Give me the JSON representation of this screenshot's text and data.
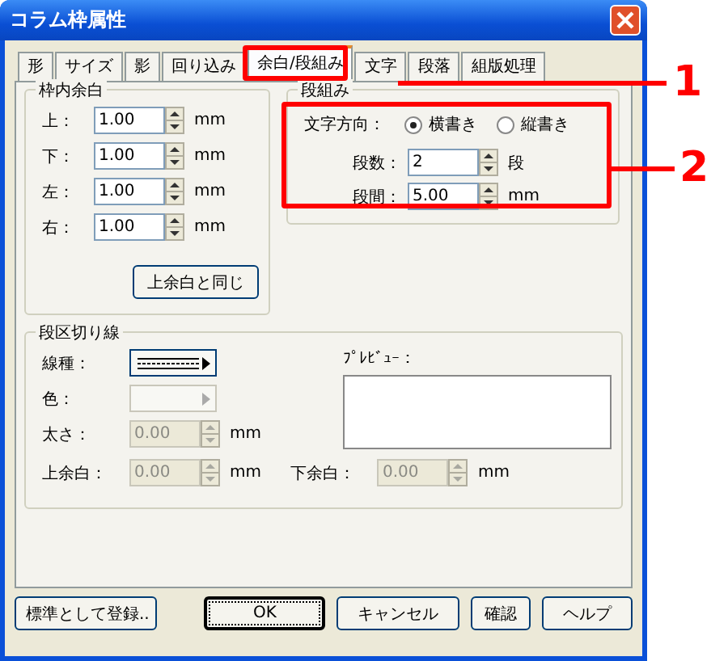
{
  "window": {
    "title": "コラム枠属性"
  },
  "tabs": [
    {
      "label": "形",
      "selected": false
    },
    {
      "label": "サイズ",
      "selected": false
    },
    {
      "label": "影",
      "selected": false
    },
    {
      "label": "回り込み",
      "selected": false
    },
    {
      "label": "余白/段組み",
      "selected": true
    },
    {
      "label": "文字",
      "selected": false
    },
    {
      "label": "段落",
      "selected": false
    },
    {
      "label": "組版処理",
      "selected": false
    }
  ],
  "inner_margin": {
    "title": "枠内余白",
    "rows": [
      {
        "label": "上：",
        "value": "1.00",
        "unit": "mm"
      },
      {
        "label": "下：",
        "value": "1.00",
        "unit": "mm"
      },
      {
        "label": "左：",
        "value": "1.00",
        "unit": "mm"
      },
      {
        "label": "右：",
        "value": "1.00",
        "unit": "mm"
      }
    ],
    "button": "上余白と同じ"
  },
  "columns": {
    "title": "段組み",
    "direction_label": "文字方向：",
    "options": [
      {
        "label": "横書き",
        "selected": true
      },
      {
        "label": "縦書き",
        "selected": false
      }
    ],
    "rows": [
      {
        "label": "段数：",
        "value": "2",
        "unit": "段"
      },
      {
        "label": "段間：",
        "value": "5.00",
        "unit": "mm"
      }
    ]
  },
  "divider": {
    "title": "段区切り線",
    "line_type_label": "線種：",
    "color_label": "色：",
    "color_disabled": true,
    "thickness": {
      "label": "太さ：",
      "value": "0.00",
      "unit": "mm",
      "disabled": true
    },
    "top_margin": {
      "label": "上余白：",
      "value": "0.00",
      "unit": "mm",
      "disabled": true
    },
    "bottom_margin": {
      "label": "下余白：",
      "value": "0.00",
      "unit": "mm",
      "disabled": true
    },
    "preview_label": "ﾌﾟﾚﾋﾞｭｰ："
  },
  "buttons": [
    {
      "label": "標準として登録..",
      "default": false
    },
    {
      "label": "OK",
      "default": true
    },
    {
      "label": "キャンセル",
      "default": false
    },
    {
      "label": "確認",
      "default": false
    },
    {
      "label": "ヘルプ",
      "default": false
    }
  ],
  "callouts": [
    {
      "number": "1"
    },
    {
      "number": "2"
    }
  ]
}
